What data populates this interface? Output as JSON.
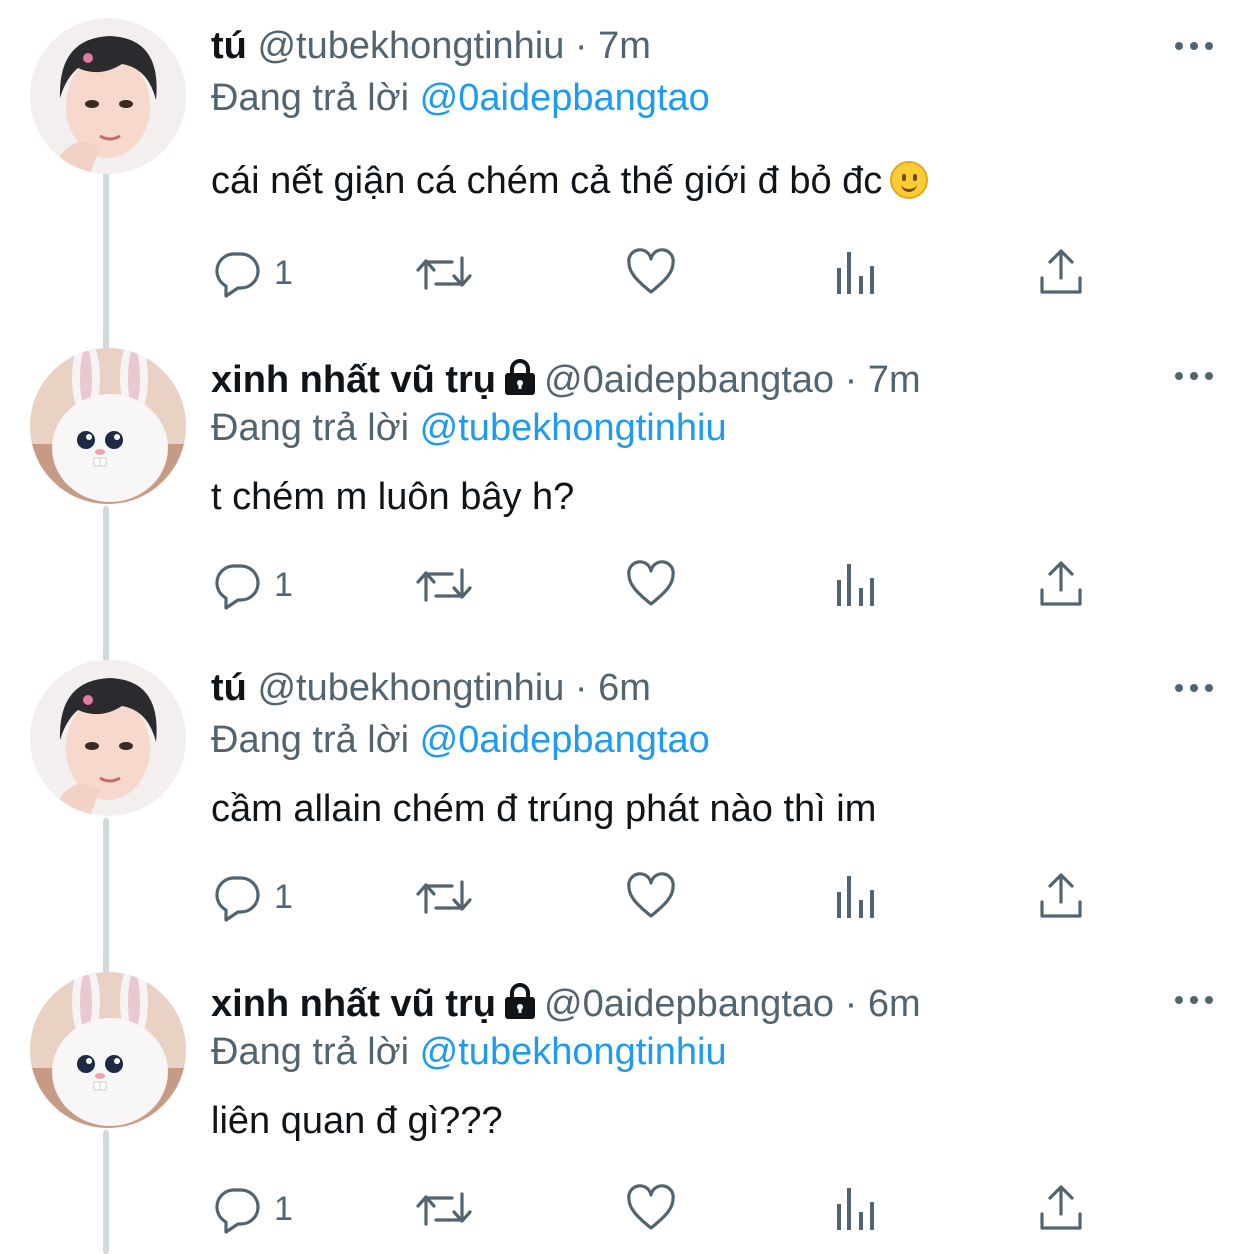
{
  "tweets": [
    {
      "display_name": "tú",
      "handle": "@tubekhongtinhiu",
      "separator": " · ",
      "time": "7m",
      "locked": false,
      "avatar": "boy-avatar",
      "reply_prefix": "Đang trả lời ",
      "reply_to": "@0aidepbangtao",
      "text": "cái nết giận cá chém cả thế giới đ bỏ đc",
      "emoji": "slightly-smiling-face",
      "reply_count": "1"
    },
    {
      "display_name": "xinh nhất vũ trụ",
      "handle": "@0aidepbangtao",
      "separator": " · ",
      "time": "7m",
      "locked": true,
      "avatar": "bunny-avatar",
      "reply_prefix": "Đang trả lời ",
      "reply_to": "@tubekhongtinhiu",
      "text": "t chém m luôn bây h?",
      "reply_count": "1"
    },
    {
      "display_name": "tú",
      "handle": "@tubekhongtinhiu",
      "separator": " · ",
      "time": "6m",
      "locked": false,
      "avatar": "boy-avatar",
      "reply_prefix": "Đang trả lời ",
      "reply_to": "@0aidepbangtao",
      "text": "cầm allain chém đ trúng phát nào thì im",
      "reply_count": "1"
    },
    {
      "display_name": "xinh nhất vũ trụ",
      "handle": "@0aidepbangtao",
      "separator": " · ",
      "time": "6m",
      "locked": true,
      "avatar": "bunny-avatar",
      "reply_prefix": "Đang trả lời ",
      "reply_to": "@tubekhongtinhiu",
      "text": "liên quan đ gì???",
      "reply_count": "1"
    }
  ],
  "icons": {
    "reply": "reply-icon",
    "retweet": "retweet-icon",
    "like": "like-icon",
    "views": "views-icon",
    "share": "share-icon",
    "more": "more-icon",
    "lock": "lock-icon"
  },
  "colors": {
    "text": "#0f1419",
    "secondary": "#536471",
    "accent": "#1d9bf0",
    "thread_line": "#cfd9de"
  }
}
